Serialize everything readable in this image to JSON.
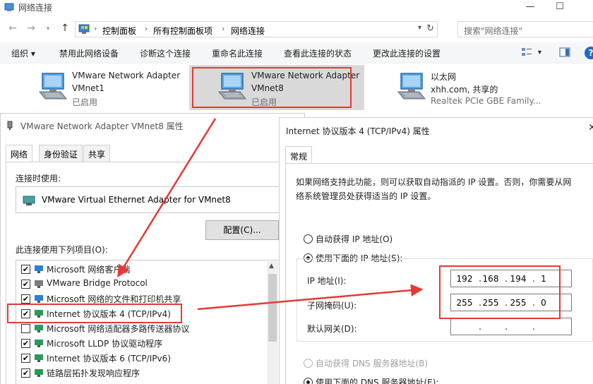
{
  "window": {
    "title": "网络连接",
    "controls": {
      "minimize": "—",
      "maximize": "☐"
    }
  },
  "address": {
    "crumbs": [
      "控制面板",
      "所有控制面板项",
      "网络连接"
    ],
    "search_placeholder": "搜索\"网络连接\""
  },
  "toolbar": {
    "organize": "组织 ▾",
    "disable": "禁用此网络设备",
    "diagnose": "诊断这个连接",
    "rename": "重命名此连接",
    "status": "查看此连接的状态",
    "change": "更改此连接的设置",
    "help": "?"
  },
  "adapters": [
    {
      "name": "VMware Network Adapter",
      "sub": "VMnet1",
      "status": "已启用"
    },
    {
      "name": "VMware Network Adapter",
      "sub": "VMnet8",
      "status": "已启用"
    },
    {
      "name": "以太网",
      "sub": "xhh.com, 共享的",
      "status": "Realtek PCIe GBE Family..."
    }
  ],
  "properties_dialog": {
    "title": "VMware Network Adapter VMnet8 属性",
    "tabs": [
      "网络",
      "身份验证",
      "共享"
    ],
    "connect_using_label": "连接时使用:",
    "adapter_name": "VMware Virtual Ethernet Adapter for VMnet8",
    "configure_button": "配置(C)...",
    "items_label": "此连接使用下列项目(O):",
    "items": [
      {
        "label": "Microsoft 网络客户端",
        "checked": true
      },
      {
        "label": "VMware Bridge Protocol",
        "checked": true
      },
      {
        "label": "Microsoft 网络的文件和打印机共享",
        "checked": true
      },
      {
        "label": "Internet 协议版本 4 (TCP/IPv4)",
        "checked": true
      },
      {
        "label": "Microsoft 网络适配器多路传送器协议",
        "checked": false
      },
      {
        "label": "Microsoft LLDP 协议驱动程序",
        "checked": true
      },
      {
        "label": "Internet 协议版本 6 (TCP/IPv6)",
        "checked": true
      },
      {
        "label": "链路层拓扑发现响应程序",
        "checked": true
      }
    ]
  },
  "ipv4_dialog": {
    "title": "Internet 协议版本 4 (TCP/IPv4) 属性",
    "tab": "常规",
    "description": "如果网络支持此功能，则可以获取自动指派的 IP 设置。否则，你需要从网络系统管理员处获得适当的 IP 设置。",
    "auto_ip": "自动获得 IP 地址(O)",
    "manual_ip": "使用下面的 IP 地址(S):",
    "ip_label": "IP 地址(I):",
    "mask_label": "子网掩码(U):",
    "gateway_label": "默认网关(D):",
    "ip": [
      "192",
      "168",
      "194",
      "1"
    ],
    "mask": [
      "255",
      "255",
      "255",
      "0"
    ],
    "gateway": [
      "",
      "",
      "",
      ""
    ],
    "auto_dns": "自动获得 DNS 服务器地址(B)",
    "manual_dns": "使用下面的 DNS 服务器地址(E):"
  },
  "annotation_color": "#e53935"
}
